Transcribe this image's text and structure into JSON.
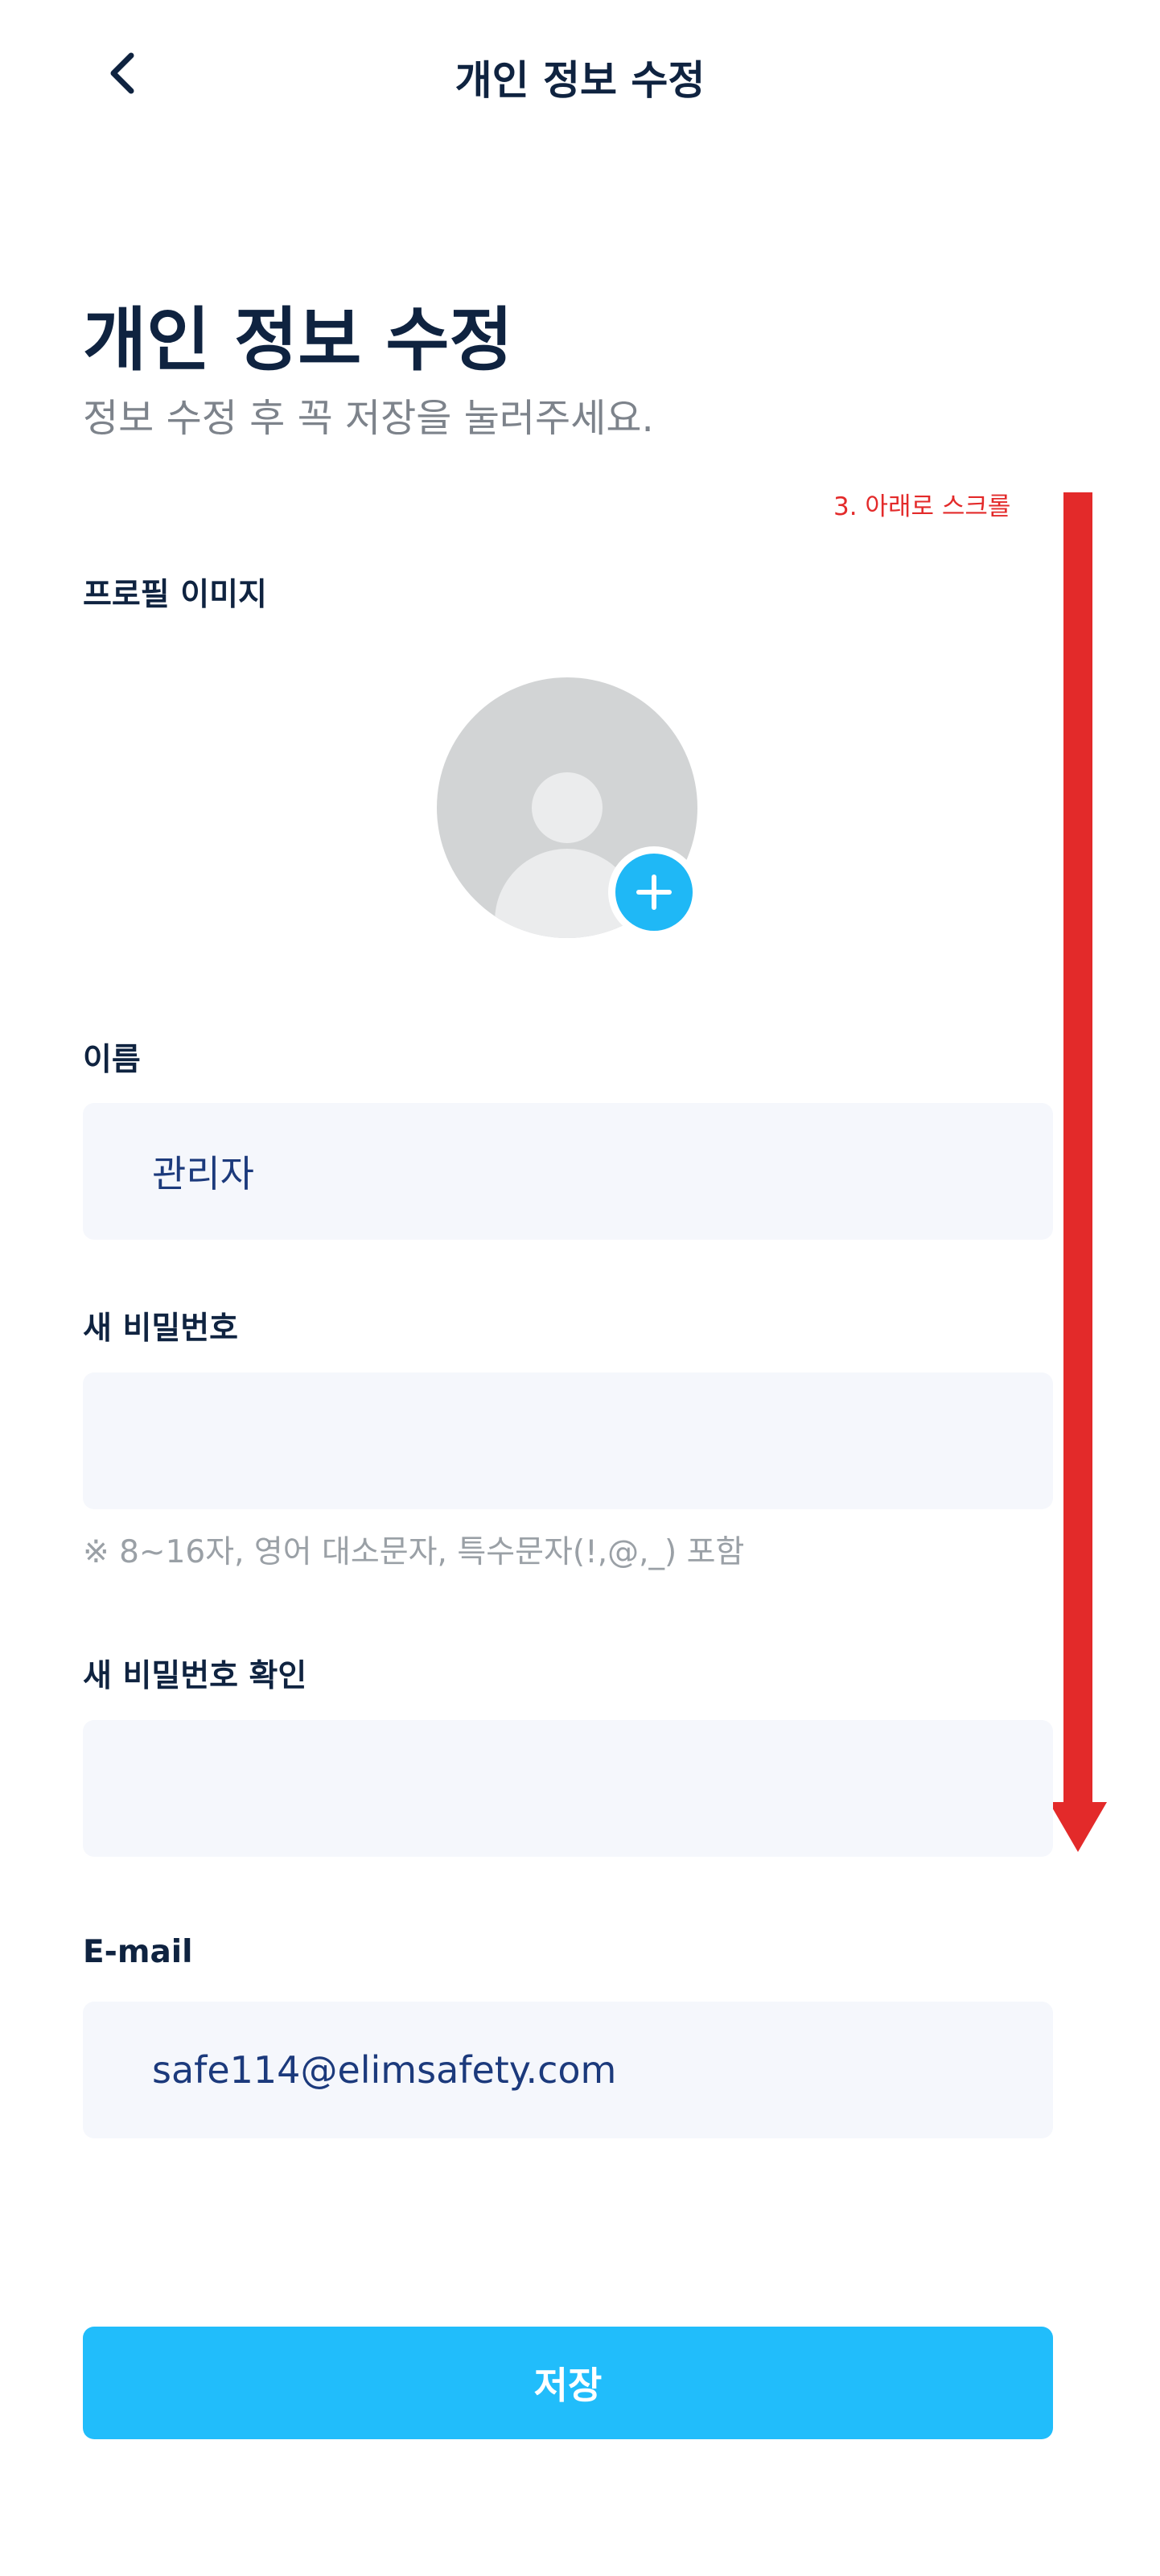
{
  "appbar": {
    "title": "개인 정보 수정",
    "back_icon": "chevron-left-icon"
  },
  "header": {
    "title": "개인 정보 수정",
    "subtitle": "정보 수정 후 꼭 저장을 눌러주세요."
  },
  "annotation": {
    "text": "3. 아래로 스크롤",
    "color": "#e32a2a"
  },
  "profile": {
    "label": "프로필 이미지",
    "add_icon": "plus-icon"
  },
  "name": {
    "label": "이름",
    "value": "관리자"
  },
  "new_password": {
    "label": "새 비밀번호",
    "value": "",
    "hint": "※ 8~16자, 영어 대소문자, 특수문자(!,@,_) 포함"
  },
  "confirm_password": {
    "label": "새 비밀번호 확인",
    "value": ""
  },
  "email": {
    "label": "E-mail",
    "value": "safe114@elimsafety.com"
  },
  "save_button": {
    "label": "저장"
  },
  "colors": {
    "accent": "#21bdfb",
    "title": "#0f2340",
    "field_bg": "#f5f7fc",
    "field_text": "#1c3a7c",
    "annotation": "#e32a2a"
  }
}
